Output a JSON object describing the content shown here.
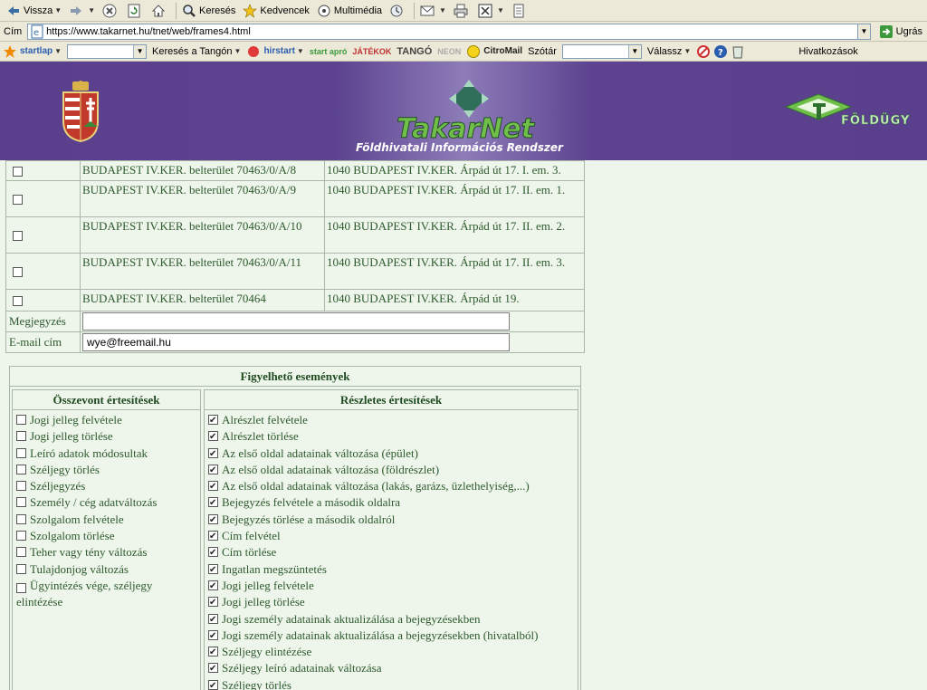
{
  "toolbar": {
    "back_label": "Vissza",
    "search_label": "Keresés",
    "favorites_label": "Kedvencek",
    "media_label": "Multimédia"
  },
  "address": {
    "label": "Cím",
    "url": "https://www.takarnet.hu/tnet/web/frames4.html",
    "go_label": "Ugrás"
  },
  "linkbar": {
    "startlap": "startlap",
    "search_tango": "Keresés a Tangón",
    "hirstart": "hirstart",
    "startapro": "start apró",
    "jatekok": "JÁTÉKOK",
    "tango": "TANGÓ",
    "neon": "NEON",
    "citromail": "CitroMail",
    "szotar": "Szótár",
    "valassz": "Válassz",
    "hivatkozasok": "Hivatkozások"
  },
  "banner": {
    "logo_text": "TakarNet",
    "subtitle": "Földhivatali Információs Rendszer",
    "right_logo_text": "FÖLDÜGY"
  },
  "properties": [
    {
      "checked": false,
      "property": "BUDAPEST IV.KER. belterület 70463/0/A/8",
      "address": "1040 BUDAPEST IV.KER. Árpád út 17. I. em. 3."
    },
    {
      "checked": false,
      "property": "BUDAPEST IV.KER. belterület 70463/0/A/9",
      "address": "1040 BUDAPEST IV.KER. Árpád út 17. II. em. 1."
    },
    {
      "checked": false,
      "property": "BUDAPEST IV.KER. belterület 70463/0/A/10",
      "address": "1040 BUDAPEST IV.KER. Árpád út 17. II. em. 2."
    },
    {
      "checked": false,
      "property": "BUDAPEST IV.KER. belterület 70463/0/A/11",
      "address": "1040 BUDAPEST IV.KER. Árpád út 17. II. em. 3."
    },
    {
      "checked": false,
      "property": "BUDAPEST IV.KER. belterület 70464",
      "address": "1040 BUDAPEST IV.KER. Árpád út 19."
    }
  ],
  "form": {
    "note_label": "Megjegyzés",
    "note_value": "",
    "email_label": "E-mail cím",
    "email_value": "wye@freemail.hu"
  },
  "events": {
    "title": "Figyelhető események",
    "summary_header": "Összevont értesítések",
    "detail_header": "Részletes értesítések",
    "summary": [
      {
        "label": "Jogi jelleg felvétele",
        "checked": false
      },
      {
        "label": "Jogi jelleg törlése",
        "checked": false
      },
      {
        "label": "Leíró adatok módosultak",
        "checked": false
      },
      {
        "label": "Széljegy törlés",
        "checked": false
      },
      {
        "label": "Széljegyzés",
        "checked": false
      },
      {
        "label": "Személy / cég adatváltozás",
        "checked": false
      },
      {
        "label": "Szolgalom felvétele",
        "checked": false
      },
      {
        "label": "Szolgalom törlése",
        "checked": false
      },
      {
        "label": "Teher vagy tény változás",
        "checked": false
      },
      {
        "label": "Tulajdonjog változás",
        "checked": false
      },
      {
        "label": "Ügyintézés vége, széljegy elintézése",
        "checked": false
      }
    ],
    "detail": [
      {
        "label": "Alrészlet felvétele",
        "checked": true
      },
      {
        "label": "Alrészlet törlése",
        "checked": true
      },
      {
        "label": "Az első oldal adatainak változása (épület)",
        "checked": true
      },
      {
        "label": "Az első oldal adatainak változása (földrészlet)",
        "checked": true
      },
      {
        "label": "Az első oldal adatainak változása (lakás, garázs, üzlethelyiség,...)",
        "checked": true
      },
      {
        "label": "Bejegyzés felvétele a második oldalra",
        "checked": true
      },
      {
        "label": "Bejegyzés törlése a második oldalról",
        "checked": true
      },
      {
        "label": "Cím felvétel",
        "checked": true
      },
      {
        "label": "Cím törlése",
        "checked": true
      },
      {
        "label": "Ingatlan megszüntetés",
        "checked": true
      },
      {
        "label": "Jogi jelleg felvétele",
        "checked": true
      },
      {
        "label": "Jogi jelleg törlése",
        "checked": true
      },
      {
        "label": "Jogi személy adatainak aktualizálása a bejegyzésekben",
        "checked": true
      },
      {
        "label": "Jogi személy adatainak aktualizálása a bejegyzésekben (hivatalból)",
        "checked": true
      },
      {
        "label": "Széljegy elintézése",
        "checked": true
      },
      {
        "label": "Széljegy leíró adatainak változása",
        "checked": true
      },
      {
        "label": "Széljegy törlés",
        "checked": true
      }
    ]
  }
}
